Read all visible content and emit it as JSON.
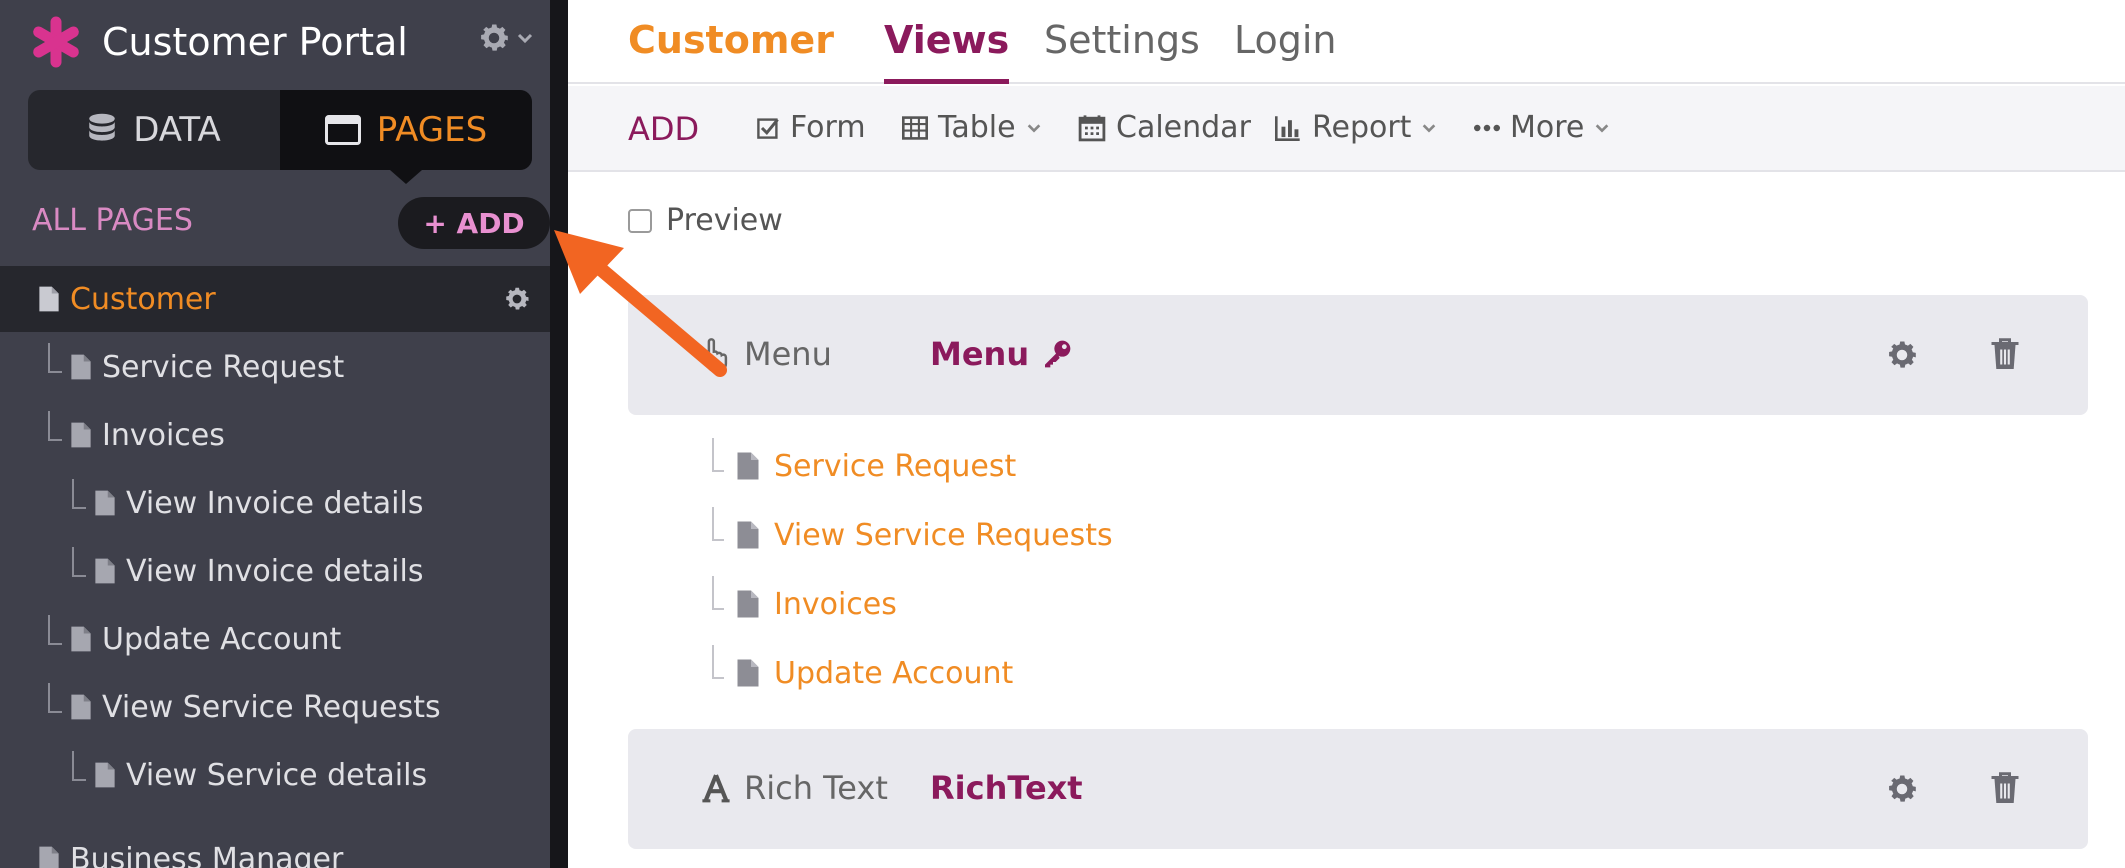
{
  "sidebar": {
    "app_title": "Customer Portal",
    "segments": {
      "data_label": "DATA",
      "pages_label": "PAGES"
    },
    "section_title": "ALL PAGES",
    "add_label": "+ ADD",
    "tree": [
      {
        "label": "Customer",
        "active": true
      },
      {
        "label": "Service Request"
      },
      {
        "label": "Invoices"
      },
      {
        "label": "View Invoice details"
      },
      {
        "label": "View Invoice details"
      },
      {
        "label": "Update Account"
      },
      {
        "label": "View Service Requests"
      },
      {
        "label": "View Service details"
      },
      {
        "label": "Business Manager"
      }
    ]
  },
  "topnav": {
    "page": "Customer",
    "tabs": [
      "Views",
      "Settings",
      "Login"
    ]
  },
  "toolbar": {
    "add_label": "ADD",
    "items": [
      "Form",
      "Table",
      "Calendar",
      "Report",
      "More"
    ]
  },
  "preview_label": "Preview",
  "views": [
    {
      "type": "Menu",
      "name": "Menu",
      "links": [
        "Service Request",
        "View Service Requests",
        "Invoices",
        "Update Account"
      ]
    },
    {
      "type": "Rich Text",
      "name": "RichText"
    }
  ],
  "colors": {
    "accent_orange": "#f08c24",
    "accent_plum": "#8b1a5c",
    "sidebar_bg": "#3f404b",
    "logo_pink": "#d9338f",
    "arrow": "#f26522"
  },
  "icons": {
    "logo": "asterisk-logo-icon",
    "settings": "gear-icon",
    "data": "database-icon",
    "pages": "window-icon",
    "page": "document-icon",
    "form": "checkbox-icon",
    "table": "table-icon",
    "calendar": "calendar-icon",
    "report": "bar-chart-icon",
    "more": "ellipsis-icon",
    "menu": "hand-pointer-icon",
    "richtext": "font-icon",
    "login_required": "key-icon",
    "delete": "trash-icon"
  }
}
